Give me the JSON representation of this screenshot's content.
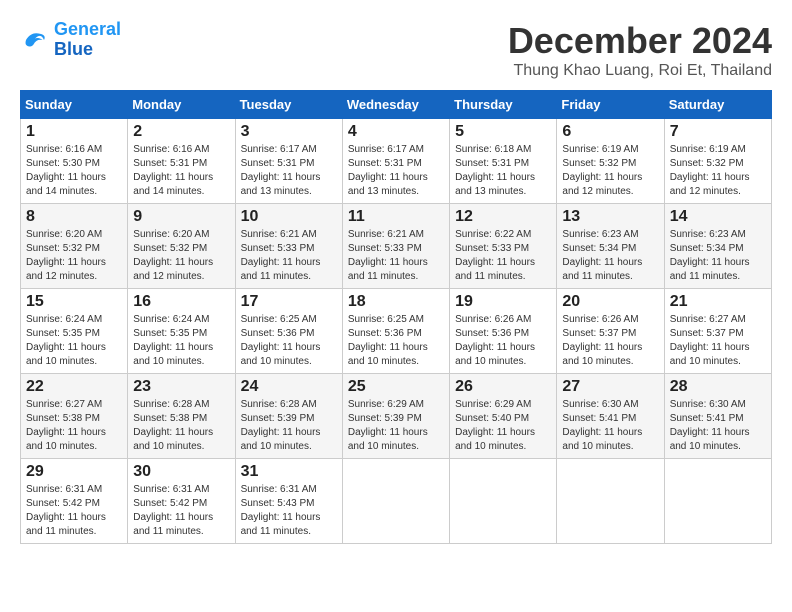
{
  "logo": {
    "line1": "General",
    "line2": "Blue"
  },
  "title": "December 2024",
  "location": "Thung Khao Luang, Roi Et, Thailand",
  "days_of_week": [
    "Sunday",
    "Monday",
    "Tuesday",
    "Wednesday",
    "Thursday",
    "Friday",
    "Saturday"
  ],
  "weeks": [
    [
      {
        "day": "1",
        "sunrise": "6:16 AM",
        "sunset": "5:30 PM",
        "daylight": "11 hours and 14 minutes."
      },
      {
        "day": "2",
        "sunrise": "6:16 AM",
        "sunset": "5:31 PM",
        "daylight": "11 hours and 14 minutes."
      },
      {
        "day": "3",
        "sunrise": "6:17 AM",
        "sunset": "5:31 PM",
        "daylight": "11 hours and 13 minutes."
      },
      {
        "day": "4",
        "sunrise": "6:17 AM",
        "sunset": "5:31 PM",
        "daylight": "11 hours and 13 minutes."
      },
      {
        "day": "5",
        "sunrise": "6:18 AM",
        "sunset": "5:31 PM",
        "daylight": "11 hours and 13 minutes."
      },
      {
        "day": "6",
        "sunrise": "6:19 AM",
        "sunset": "5:32 PM",
        "daylight": "11 hours and 12 minutes."
      },
      {
        "day": "7",
        "sunrise": "6:19 AM",
        "sunset": "5:32 PM",
        "daylight": "11 hours and 12 minutes."
      }
    ],
    [
      {
        "day": "8",
        "sunrise": "6:20 AM",
        "sunset": "5:32 PM",
        "daylight": "11 hours and 12 minutes."
      },
      {
        "day": "9",
        "sunrise": "6:20 AM",
        "sunset": "5:32 PM",
        "daylight": "11 hours and 12 minutes."
      },
      {
        "day": "10",
        "sunrise": "6:21 AM",
        "sunset": "5:33 PM",
        "daylight": "11 hours and 11 minutes."
      },
      {
        "day": "11",
        "sunrise": "6:21 AM",
        "sunset": "5:33 PM",
        "daylight": "11 hours and 11 minutes."
      },
      {
        "day": "12",
        "sunrise": "6:22 AM",
        "sunset": "5:33 PM",
        "daylight": "11 hours and 11 minutes."
      },
      {
        "day": "13",
        "sunrise": "6:23 AM",
        "sunset": "5:34 PM",
        "daylight": "11 hours and 11 minutes."
      },
      {
        "day": "14",
        "sunrise": "6:23 AM",
        "sunset": "5:34 PM",
        "daylight": "11 hours and 11 minutes."
      }
    ],
    [
      {
        "day": "15",
        "sunrise": "6:24 AM",
        "sunset": "5:35 PM",
        "daylight": "11 hours and 10 minutes."
      },
      {
        "day": "16",
        "sunrise": "6:24 AM",
        "sunset": "5:35 PM",
        "daylight": "11 hours and 10 minutes."
      },
      {
        "day": "17",
        "sunrise": "6:25 AM",
        "sunset": "5:36 PM",
        "daylight": "11 hours and 10 minutes."
      },
      {
        "day": "18",
        "sunrise": "6:25 AM",
        "sunset": "5:36 PM",
        "daylight": "11 hours and 10 minutes."
      },
      {
        "day": "19",
        "sunrise": "6:26 AM",
        "sunset": "5:36 PM",
        "daylight": "11 hours and 10 minutes."
      },
      {
        "day": "20",
        "sunrise": "6:26 AM",
        "sunset": "5:37 PM",
        "daylight": "11 hours and 10 minutes."
      },
      {
        "day": "21",
        "sunrise": "6:27 AM",
        "sunset": "5:37 PM",
        "daylight": "11 hours and 10 minutes."
      }
    ],
    [
      {
        "day": "22",
        "sunrise": "6:27 AM",
        "sunset": "5:38 PM",
        "daylight": "11 hours and 10 minutes."
      },
      {
        "day": "23",
        "sunrise": "6:28 AM",
        "sunset": "5:38 PM",
        "daylight": "11 hours and 10 minutes."
      },
      {
        "day": "24",
        "sunrise": "6:28 AM",
        "sunset": "5:39 PM",
        "daylight": "11 hours and 10 minutes."
      },
      {
        "day": "25",
        "sunrise": "6:29 AM",
        "sunset": "5:39 PM",
        "daylight": "11 hours and 10 minutes."
      },
      {
        "day": "26",
        "sunrise": "6:29 AM",
        "sunset": "5:40 PM",
        "daylight": "11 hours and 10 minutes."
      },
      {
        "day": "27",
        "sunrise": "6:30 AM",
        "sunset": "5:41 PM",
        "daylight": "11 hours and 10 minutes."
      },
      {
        "day": "28",
        "sunrise": "6:30 AM",
        "sunset": "5:41 PM",
        "daylight": "11 hours and 10 minutes."
      }
    ],
    [
      {
        "day": "29",
        "sunrise": "6:31 AM",
        "sunset": "5:42 PM",
        "daylight": "11 hours and 11 minutes."
      },
      {
        "day": "30",
        "sunrise": "6:31 AM",
        "sunset": "5:42 PM",
        "daylight": "11 hours and 11 minutes."
      },
      {
        "day": "31",
        "sunrise": "6:31 AM",
        "sunset": "5:43 PM",
        "daylight": "11 hours and 11 minutes."
      },
      null,
      null,
      null,
      null
    ]
  ]
}
